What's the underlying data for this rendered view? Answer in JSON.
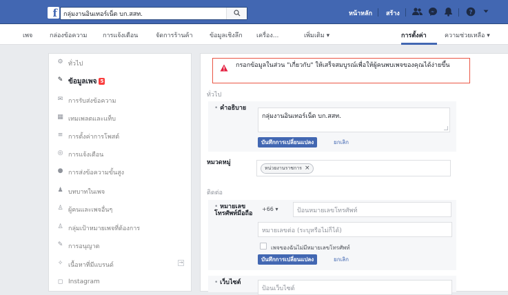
{
  "topbar": {
    "logo": "f",
    "search_value": "กลุ่มงานอินเทอร์เน็ต บก.สสท.",
    "search_icon": "search-icon",
    "home_label": "หน้าหลัก",
    "create_label": "สร้าง",
    "icons": [
      "friends-icon",
      "messenger-icon",
      "notifications-icon",
      "help-icon",
      "caret-down-icon"
    ]
  },
  "tabs": {
    "items": [
      "เพจ",
      "กล่องข้อความ",
      "การแจ้งเตือน",
      "จัดการร้านค้า",
      "ข้อมูลเชิงลึก",
      "เครื่อง..."
    ],
    "more": "เพิ่มเติม ▾",
    "settings": "การตั้งค่า",
    "help": "ความช่วยเหลือ ▾"
  },
  "sidebar": {
    "items": [
      {
        "label": "ทั่วไป",
        "icon": "gear-icon",
        "glyph": "⚙"
      },
      {
        "label": "ข้อมูลเพจ",
        "icon": "pencil-icon",
        "glyph": "✎",
        "badge": "5"
      },
      {
        "label": "การรับส่งข้อความ",
        "icon": "chat-icon",
        "glyph": "✉"
      },
      {
        "label": "เทมเพลตและแท็บ",
        "icon": "grid-icon",
        "glyph": "▦"
      },
      {
        "label": "การตั้งค่าการโพสต์",
        "icon": "list-icon",
        "glyph": "≡"
      },
      {
        "label": "การแจ้งเตือน",
        "icon": "globe-icon",
        "glyph": "◎"
      },
      {
        "label": "การส่งข้อความขั้นสูง",
        "icon": "message-icon",
        "glyph": "●"
      },
      {
        "label": "บทบาทในเพจ",
        "icon": "person-icon",
        "glyph": "♟"
      },
      {
        "label": "ผู้คนและเพจอื่นๆ",
        "icon": "people-icon",
        "glyph": "♙"
      },
      {
        "label": "กลุ่มเป้าหมายเพจที่ต้องการ",
        "icon": "audience-icon",
        "glyph": "♙"
      },
      {
        "label": "การอนุญาต",
        "icon": "wrench-icon",
        "glyph": "✎"
      },
      {
        "label": "เนื้อหาที่มีแบรนด์",
        "icon": "handshake-icon",
        "glyph": "✧"
      },
      {
        "label": "Instagram",
        "icon": "instagram-icon",
        "glyph": "◻"
      }
    ]
  },
  "main": {
    "alert": "กรอกข้อมูลในส่วน \"เกี่ยวกับ\" ให้เสร็จสมบูรณ์เพื่อให้ผู้คนพบเพจของคุณได้ง่ายขึ้น",
    "section_general": "ทั่วไป",
    "description_label": "คำอธิบาย",
    "description_value": "กลุ่มงานอินเทอร์เน็ต บก.สสท.",
    "save_label": "บันทึกการเปลี่ยนแปลง",
    "cancel_label": "ยกเลิก",
    "category_label": "หมวดหมู่",
    "category_chip": "หน่วยงานราชการ",
    "section_contact": "ติดต่อ",
    "phone_label": "หมายเลขโทรศัพท์มือถือ",
    "country_code": "+66",
    "phone_placeholder": "ป้อนหมายเลขโทรศัพท์",
    "ext_placeholder": "หมายเลขต่อ (ระบุหรือไม่ก็ได้)",
    "no_phone_label": "เพจของฉันไม่มีหมายเลขโทรศัพท์",
    "website_label": "เว็บไซต์",
    "website_placeholder": "ป้อนเว็บไซต์"
  }
}
